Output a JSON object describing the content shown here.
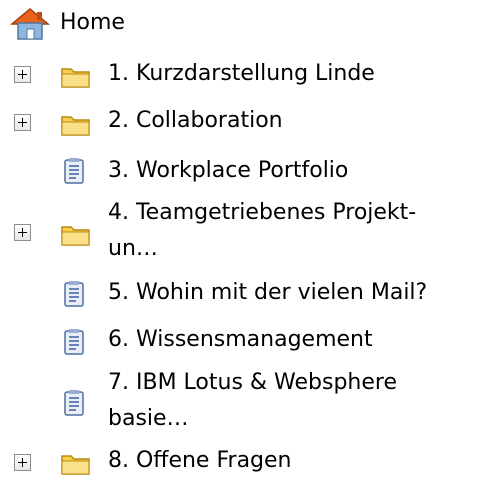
{
  "tree": {
    "root": {
      "label": "Home",
      "icon": "home-icon"
    },
    "items": [
      {
        "number": "1",
        "label": "1. Kurzdarstellung Linde",
        "type": "folder",
        "expandable": true
      },
      {
        "number": "2",
        "label": "2. Collaboration",
        "type": "folder",
        "expandable": true
      },
      {
        "number": "3",
        "label": "3. Workplace Portfolio",
        "type": "document",
        "expandable": false
      },
      {
        "number": "4",
        "label_line1": "4. Teamgetriebenes Projekt-",
        "label_line2": "un…",
        "type": "folder",
        "expandable": true
      },
      {
        "number": "5",
        "label": "5. Wohin mit der vielen Mail?",
        "type": "document",
        "expandable": false
      },
      {
        "number": "6",
        "label": "6. Wissensmanagement",
        "type": "document",
        "expandable": false
      },
      {
        "number": "7",
        "label_line1": "7. IBM Lotus & Websphere",
        "label_line2": "basie…",
        "type": "document",
        "expandable": false
      },
      {
        "number": "8",
        "label": "8. Offene Fragen",
        "type": "folder",
        "expandable": true
      }
    ]
  },
  "colors": {
    "folder": "#f7cf4a",
    "folder_dark": "#b98a10",
    "house_roof": "#e8631c",
    "house_wall": "#8fb6dd",
    "document": "#e9eef7",
    "document_lines": "#3d5fa0"
  }
}
